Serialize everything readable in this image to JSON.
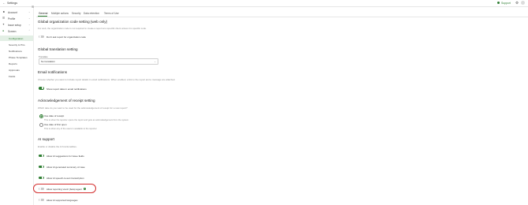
{
  "topbar": {
    "title": "Settings",
    "support_label": "Support"
  },
  "sidebar": {
    "items": [
      {
        "label": "Account",
        "icon": "person-icon"
      },
      {
        "label": "Profile",
        "icon": "profile-icon"
      },
      {
        "label": "Issue setup",
        "icon": "wrench-icon"
      },
      {
        "label": "Screen",
        "icon": "screen-icon"
      }
    ],
    "subitems": [
      {
        "label": "Configuration",
        "active": true
      },
      {
        "label": "Severity & Prio"
      },
      {
        "label": "Notifications"
      },
      {
        "label": "Phase Templates"
      },
      {
        "label": "Reports"
      },
      {
        "label": "Approvals"
      },
      {
        "label": "Fields"
      }
    ]
  },
  "tabs": [
    "General",
    "Multiple actions",
    "Security",
    "Data retention",
    "Terms of Use"
  ],
  "sections": {
    "global_org_code": {
      "title": "Global organization code setting (web only)",
      "desc": "For web, the organization code is not required to create a report at a specific client unless it is specific code.",
      "toggle_label": "Don't ask report for organization code"
    },
    "global_translation": {
      "title": "Global translation setting",
      "field_label": "Translate",
      "field_value": "No translation"
    },
    "email_notifications": {
      "title": "Email notifications",
      "desc": "Choose whether you want to Include report details in email notifications. When enabled, a link to the report and a message are attached.",
      "toggle_label": "Show report data in email notifications"
    },
    "ack_receipt": {
      "title": "Acknowledgement of receipt setting",
      "desc": "Which date do you want to be used for the acknowledgement of receipt for a new report?",
      "options": [
        {
          "label": "Use date of receipt",
          "sub": "This is when the reporter opens the report and gets an acknowledgement from the system.",
          "checked": true
        },
        {
          "label": "Use date of first open",
          "sub": "This is when any of the users in available to the reporter.",
          "checked": false
        }
      ]
    },
    "ai_support": {
      "title": "AI support",
      "desc": "Enable or disable the AI functionalities.",
      "toggles": [
        {
          "label": "Allow AI suggestions for Issue fields",
          "on": true
        },
        {
          "label": "Allow AI generated summary of case",
          "on": true
        },
        {
          "label": "Allow AI speech-to-text transcription",
          "on": true
        },
        {
          "label": "Allow reporting via AI (beta) agent",
          "on": false
        },
        {
          "label": "Allow AI supported languages",
          "on": false
        }
      ]
    }
  },
  "colors": {
    "accent": "#2e7d32",
    "highlight": "#d32f2f"
  }
}
